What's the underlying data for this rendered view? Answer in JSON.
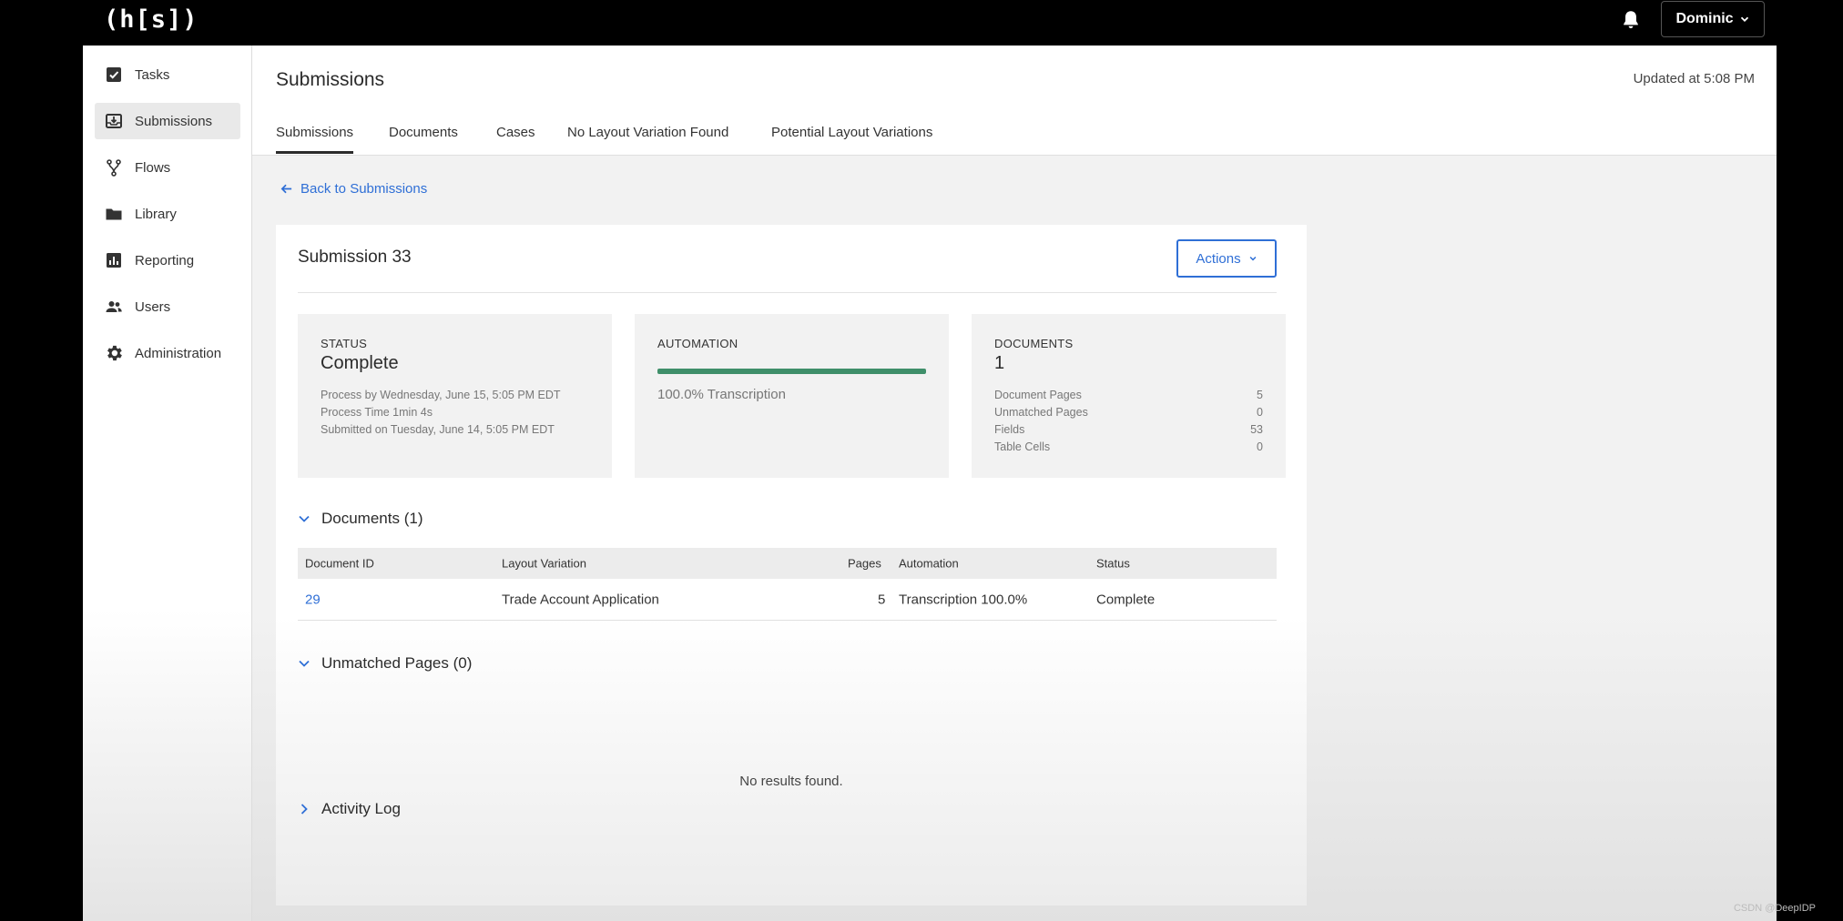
{
  "topbar": {
    "logo": "(h[s])",
    "user": "Dominic",
    "icons": {
      "bell": "bell-icon",
      "caret": "chevron-down-icon"
    }
  },
  "sidebar": {
    "items": [
      {
        "label": "Tasks",
        "icon": "tasks-icon"
      },
      {
        "label": "Submissions",
        "icon": "submissions-icon",
        "active": true
      },
      {
        "label": "Flows",
        "icon": "flows-icon"
      },
      {
        "label": "Library",
        "icon": "folder-icon"
      },
      {
        "label": "Reporting",
        "icon": "chart-icon"
      },
      {
        "label": "Users",
        "icon": "users-icon"
      },
      {
        "label": "Administration",
        "icon": "gear-icon"
      }
    ]
  },
  "header": {
    "title": "Submissions",
    "updated": "Updated at 5:08 PM",
    "tabs": [
      {
        "label": "Submissions",
        "active": true
      },
      {
        "label": "Documents"
      },
      {
        "label": "Cases"
      },
      {
        "label": "No Layout Variation Found"
      },
      {
        "label": "Potential Layout Variations"
      }
    ]
  },
  "back_link": "Back to Submissions",
  "submission": {
    "title": "Submission 33",
    "actions_label": "Actions",
    "status": {
      "label": "STATUS",
      "value": "Complete",
      "lines": [
        "Process by Wednesday, June 15, 5:05 PM EDT",
        "Process Time 1min 4s",
        "Submitted on Tuesday, June 14, 5:05 PM EDT"
      ]
    },
    "automation": {
      "label": "AUTOMATION",
      "progress_percent": 100,
      "text": "100.0% Transcription"
    },
    "documents": {
      "label": "DOCUMENTS",
      "value": "1",
      "rows": [
        {
          "name": "Document Pages",
          "value": "5"
        },
        {
          "name": "Unmatched Pages",
          "value": "0"
        },
        {
          "name": "Fields",
          "value": "53"
        },
        {
          "name": "Table Cells",
          "value": "0"
        }
      ]
    }
  },
  "documents_section": {
    "title": "Documents (1)",
    "columns": [
      "Document ID",
      "Layout Variation",
      "Pages",
      "Automation",
      "Status"
    ],
    "rows": [
      {
        "id": "29",
        "layout": "Trade Account Application",
        "pages": "5",
        "automation": "Transcription 100.0%",
        "status": "Complete"
      }
    ]
  },
  "unmatched_section": {
    "title": "Unmatched Pages (0)",
    "empty": "No results found."
  },
  "activity_section": {
    "title": "Activity Log"
  },
  "watermark": "CSDN @DeepIDP",
  "colors": {
    "accent": "#2f6fd6",
    "progress": "#3f8f6a"
  }
}
